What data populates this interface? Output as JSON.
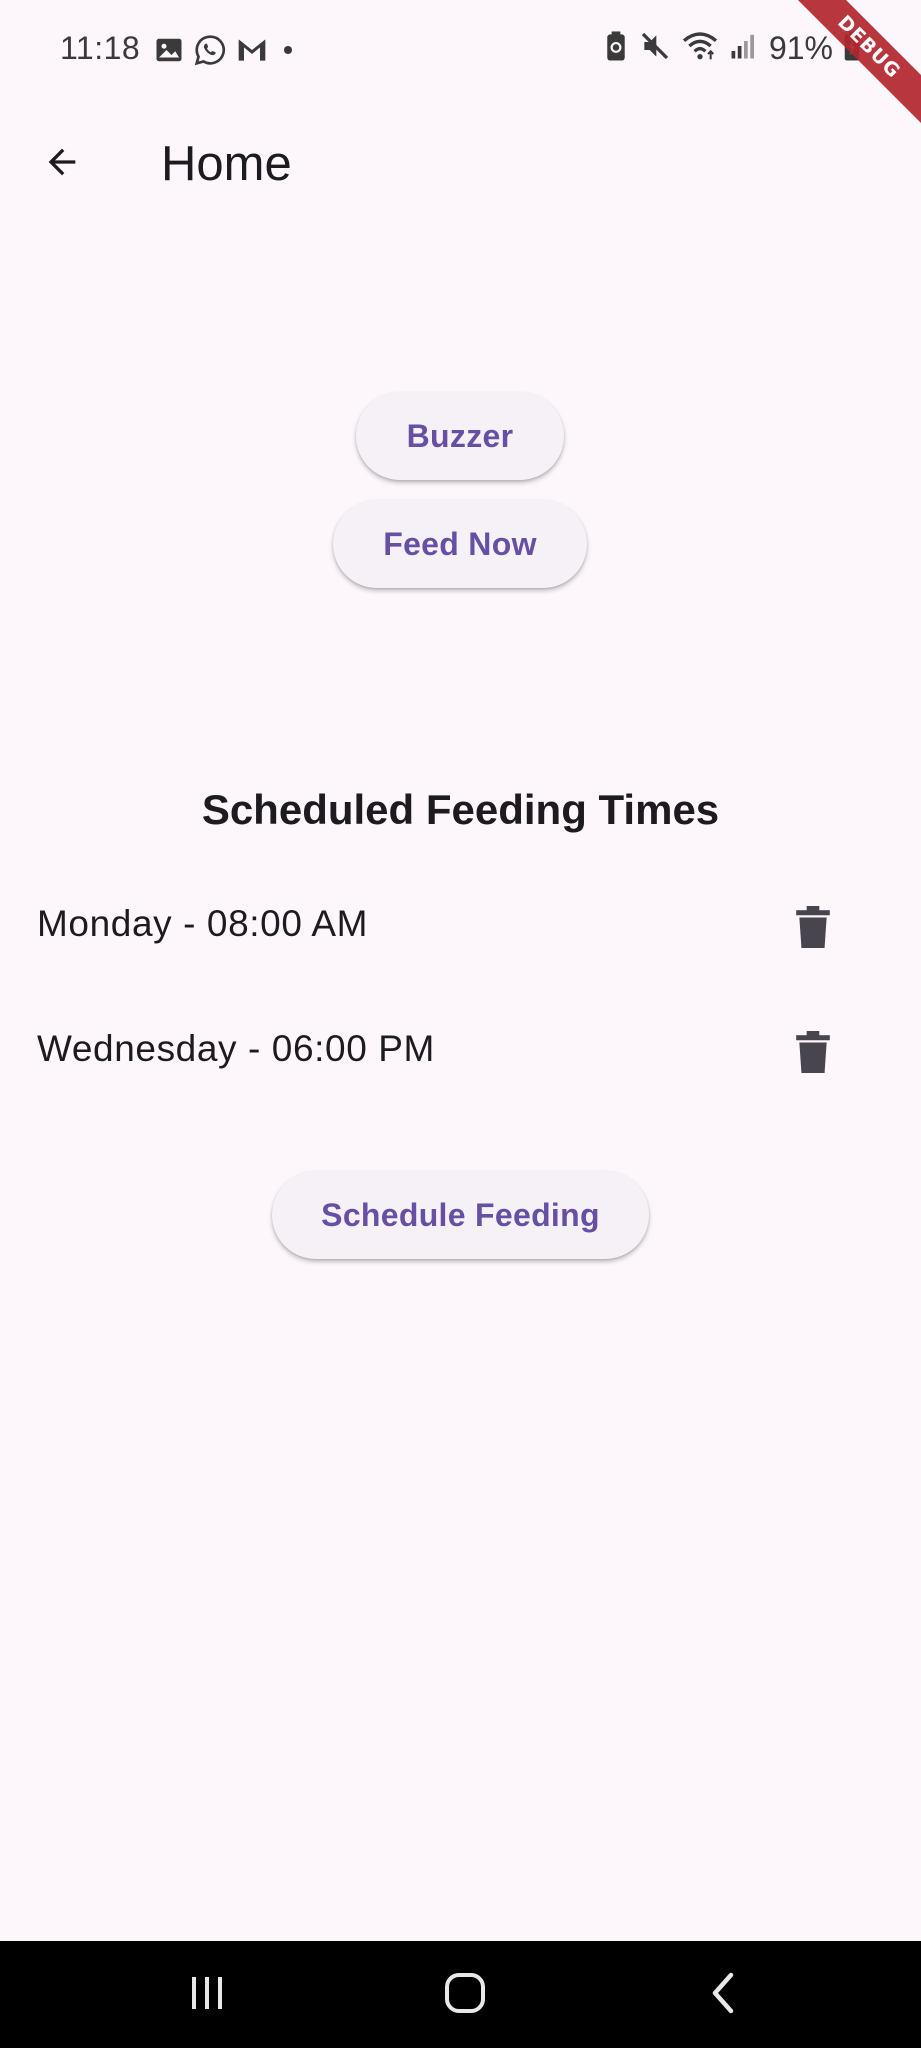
{
  "status_bar": {
    "time": "11:18",
    "left_icons": [
      "gallery-icon",
      "whatsapp-icon",
      "gmail-icon",
      "dot-icon"
    ],
    "right_icons": [
      "battery-saver-icon",
      "mute-icon",
      "wifi-icon",
      "signal-icon"
    ],
    "battery": "91%",
    "debug_label": "DEBUG"
  },
  "app_bar": {
    "title": "Home",
    "back_icon": "arrow-back-icon"
  },
  "actions": {
    "buzzer_label": "Buzzer",
    "feed_now_label": "Feed Now"
  },
  "schedule": {
    "title": "Scheduled Feeding Times",
    "items": [
      {
        "label": "Monday - 08:00 AM",
        "action_icon": "delete-icon"
      },
      {
        "label": "Wednesday - 06:00 PM",
        "action_icon": "delete-icon"
      }
    ],
    "schedule_button_label": "Schedule Feeding"
  },
  "nav_bar": {
    "buttons": [
      "recents-icon",
      "home-icon",
      "back-icon"
    ]
  },
  "colors": {
    "background": "#fdf7fc",
    "accent": "#6750a4",
    "button_surface": "#f6f1f7",
    "text": "#1d1b20",
    "icon": "#49454f",
    "debug_ribbon": "#b3262e"
  }
}
